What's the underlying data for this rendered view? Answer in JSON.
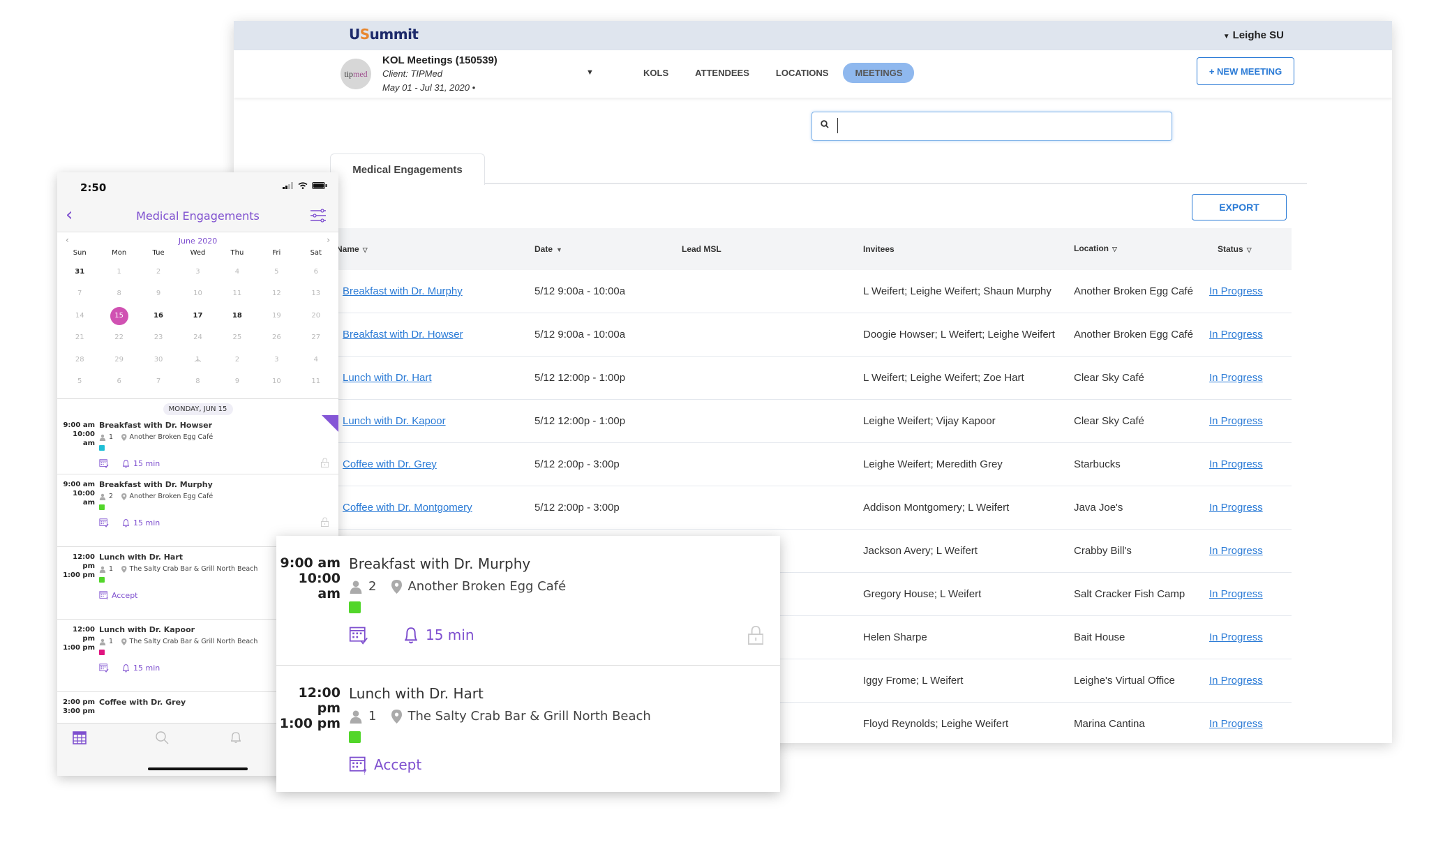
{
  "desktop": {
    "logo": {
      "u": "U",
      "s": "S",
      "rest": "ummit"
    },
    "user_menu": "Leighe SU",
    "project": {
      "logo_text_a": "tip",
      "logo_text_b": "med",
      "title": "KOL Meetings (150539)",
      "client": "Client: TIPMed",
      "dates": "May 01 - Jul 31, 2020 •"
    },
    "nav": [
      {
        "label": "KOLS",
        "active": false
      },
      {
        "label": "ATTENDEES",
        "active": false
      },
      {
        "label": "LOCATIONS",
        "active": false
      },
      {
        "label": "MEETINGS",
        "active": true
      }
    ],
    "new_meeting_label": "+ NEW MEETING",
    "search": {
      "value": "",
      "placeholder": ""
    },
    "tab_label": "Medical Engagements",
    "export_label": "EXPORT",
    "columns": [
      "Name",
      "Date",
      "Lead MSL",
      "Invitees",
      "Location",
      "Status"
    ],
    "rows": [
      {
        "name": "Breakfast with Dr. Murphy",
        "date": "5/12 9:00a - 10:00a",
        "lead": "",
        "invitees": "L Weifert; Leighe Weifert; Shaun Murphy",
        "location": "Another Broken Egg Café",
        "status": "In Progress"
      },
      {
        "name": "Breakfast with Dr. Howser",
        "date": "5/12 9:00a - 10:00a",
        "lead": "",
        "invitees": "Doogie Howser; L Weifert; Leighe Weifert",
        "location": "Another Broken Egg Café",
        "status": "In Progress"
      },
      {
        "name": "Lunch with Dr. Hart",
        "date": "5/12 12:00p - 1:00p",
        "lead": "",
        "invitees": "L Weifert; Leighe Weifert; Zoe Hart",
        "location": "Clear Sky Café",
        "status": "In Progress"
      },
      {
        "name": "Lunch with Dr. Kapoor",
        "date": "5/12 12:00p - 1:00p",
        "lead": "",
        "invitees": "Leighe Weifert; Vijay Kapoor",
        "location": "Clear Sky Café",
        "status": "In Progress"
      },
      {
        "name": "Coffee with Dr. Grey",
        "date": "5/12 2:00p - 3:00p",
        "lead": "",
        "invitees": "Leighe Weifert; Meredith Grey",
        "location": "Starbucks",
        "status": "In Progress"
      },
      {
        "name": "Coffee with Dr. Montgomery",
        "date": "5/12 2:00p - 3:00p",
        "lead": "",
        "invitees": "Addison Montgomery; L Weifert",
        "location": "Java Joe's",
        "status": "In Progress"
      },
      {
        "name": "",
        "date": "",
        "lead": "",
        "invitees": "Jackson Avery; L Weifert",
        "location": "Crabby Bill's",
        "status": "In Progress"
      },
      {
        "name": "",
        "date": "",
        "lead": "",
        "invitees": "Gregory House; L Weifert",
        "location": "Salt Cracker Fish Camp",
        "status": "In Progress"
      },
      {
        "name": "",
        "date": "",
        "lead": "",
        "invitees": "Helen Sharpe",
        "location": "Bait House",
        "status": "In Progress"
      },
      {
        "name": "",
        "date": "",
        "lead": "",
        "invitees": "Iggy Frome; L Weifert",
        "location": "Leighe's Virtual Office",
        "status": "In Progress"
      },
      {
        "name": "",
        "date": "",
        "lead": "",
        "invitees": "Floyd Reynolds; Leighe Weifert",
        "location": "Marina Cantina",
        "status": "In Progress"
      }
    ]
  },
  "phone": {
    "time": "2:50",
    "title": "Medical Engagements",
    "calendar": {
      "month": "June 2020",
      "dow": [
        "Sun",
        "Mon",
        "Tue",
        "Wed",
        "Thu",
        "Fri",
        "Sat"
      ],
      "days": [
        {
          "d": "31",
          "s": "bold"
        },
        {
          "d": "1"
        },
        {
          "d": "2"
        },
        {
          "d": "3"
        },
        {
          "d": "4"
        },
        {
          "d": "5"
        },
        {
          "d": "6"
        },
        {
          "d": "7"
        },
        {
          "d": "8"
        },
        {
          "d": "9"
        },
        {
          "d": "10"
        },
        {
          "d": "11"
        },
        {
          "d": "12"
        },
        {
          "d": "13"
        },
        {
          "d": "14"
        },
        {
          "d": "15",
          "s": "sel"
        },
        {
          "d": "16",
          "s": "bold"
        },
        {
          "d": "17",
          "s": "bold"
        },
        {
          "d": "18",
          "s": "bold"
        },
        {
          "d": "19"
        },
        {
          "d": "20"
        },
        {
          "d": "21"
        },
        {
          "d": "22"
        },
        {
          "d": "23"
        },
        {
          "d": "24"
        },
        {
          "d": "25"
        },
        {
          "d": "26"
        },
        {
          "d": "27"
        },
        {
          "d": "28"
        },
        {
          "d": "29"
        },
        {
          "d": "30"
        },
        {
          "d": "1"
        },
        {
          "d": "2"
        },
        {
          "d": "3"
        },
        {
          "d": "4"
        },
        {
          "d": "5"
        },
        {
          "d": "6"
        },
        {
          "d": "7"
        },
        {
          "d": "8"
        },
        {
          "d": "9"
        },
        {
          "d": "10"
        },
        {
          "d": "11"
        }
      ]
    },
    "date_header": "MONDAY, JUN 15",
    "events": [
      {
        "start": "9:00 am",
        "end": "10:00 am",
        "title": "Breakfast with Dr. Howser",
        "attendees": "1",
        "location": "Another Broken Egg Café",
        "color": "#1fbfd6",
        "action": "reminder",
        "reminder": "15 min",
        "locked": true,
        "badge": true
      },
      {
        "start": "9:00 am",
        "end": "10:00 am",
        "title": "Breakfast with Dr. Murphy",
        "attendees": "2",
        "location": "Another Broken Egg Café",
        "color": "#52d62a",
        "action": "reminder",
        "reminder": "15 min",
        "locked": true,
        "badge": false
      },
      {
        "start": "12:00 pm",
        "end": "1:00 pm",
        "title": "Lunch with Dr. Hart",
        "attendees": "1",
        "location": "The Salty Crab Bar & Grill North Beach",
        "color": "#52d62a",
        "action": "accept",
        "accept": "Accept",
        "locked": false,
        "badge": false
      },
      {
        "start": "12:00 pm",
        "end": "1:00 pm",
        "title": "Lunch with Dr. Kapoor",
        "attendees": "1",
        "location": "The Salty Crab Bar & Grill North Beach",
        "color": "#e0147f",
        "action": "reminder",
        "reminder": "15 min",
        "locked": false,
        "badge": false
      },
      {
        "start": "2:00 pm",
        "end": "3:00 pm",
        "title": "Coffee with Dr. Grey",
        "attendees": "",
        "location": "",
        "color": "",
        "action": "",
        "locked": false,
        "badge": false
      }
    ]
  },
  "zoom_card": {
    "events": [
      {
        "start": "9:00 am",
        "end": "10:00 am",
        "title": "Breakfast with Dr. Murphy",
        "attendees": "2",
        "location": "Another Broken Egg Café",
        "color": "#52d62a",
        "reminder": "15 min",
        "locked": true
      },
      {
        "start": "12:00 pm",
        "end": "1:00 pm",
        "title": "Lunch with Dr. Hart",
        "attendees": "1",
        "location": "The Salty Crab Bar & Grill North Beach",
        "color": "#52d62a",
        "accept": "Accept",
        "locked": false
      }
    ]
  },
  "colors": {
    "accent_blue": "#2b7bd6",
    "accent_purple": "#7e4fcf",
    "selected_day": "#d051b2",
    "active_nav": "#8fb8ee"
  }
}
